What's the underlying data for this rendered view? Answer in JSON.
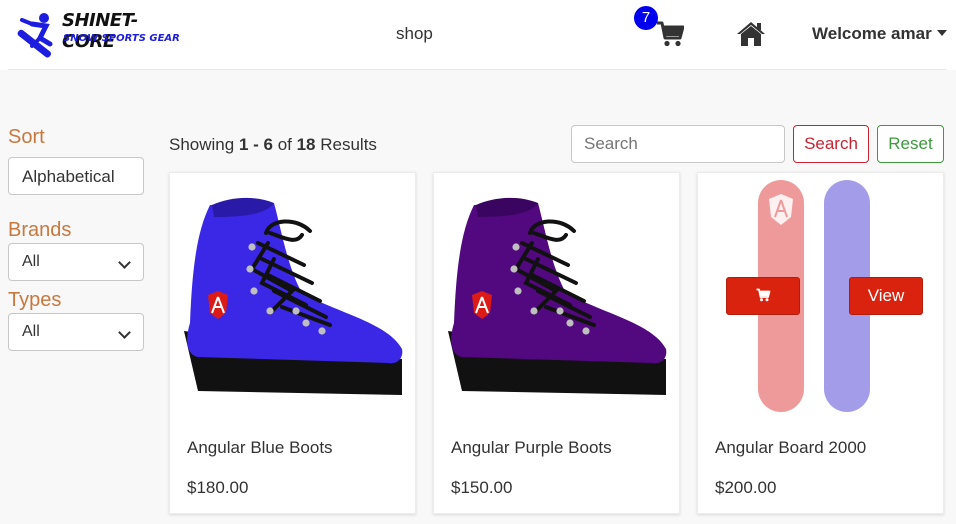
{
  "nav": {
    "logo_title": "SHINET-CORE",
    "logo_subtitle": "SNOW SPORTS GEAR",
    "shop_label": "shop",
    "cart_count": "7",
    "welcome_label": "Welcome amar"
  },
  "sidebar": {
    "sort_label": "Sort",
    "sort_value": "Alphabetical",
    "brands_label": "Brands",
    "brands_value": "All",
    "types_label": "Types",
    "types_value": "All"
  },
  "toolbar": {
    "showing_prefix": "Showing ",
    "range": "1 - 6",
    "of_text": " of ",
    "total": "18",
    "results_suffix": " Results",
    "search_placeholder": "Search",
    "search_button": "Search",
    "reset_button": "Reset"
  },
  "products": [
    {
      "name": "Angular Blue Boots",
      "price": "$180.00",
      "color": "#3b28e6"
    },
    {
      "name": "Angular Purple Boots",
      "price": "$150.00",
      "color": "#52087f"
    },
    {
      "name": "Angular Board 2000",
      "price": "$200.00",
      "color": "#ef9a9a",
      "overlay_view_label": "View",
      "overlay_cart_icon": "cart-icon"
    }
  ],
  "colors": {
    "accent": "#c8783f",
    "danger": "#d9230f",
    "success": "#3d9a3d",
    "badge": "#0000ee"
  }
}
